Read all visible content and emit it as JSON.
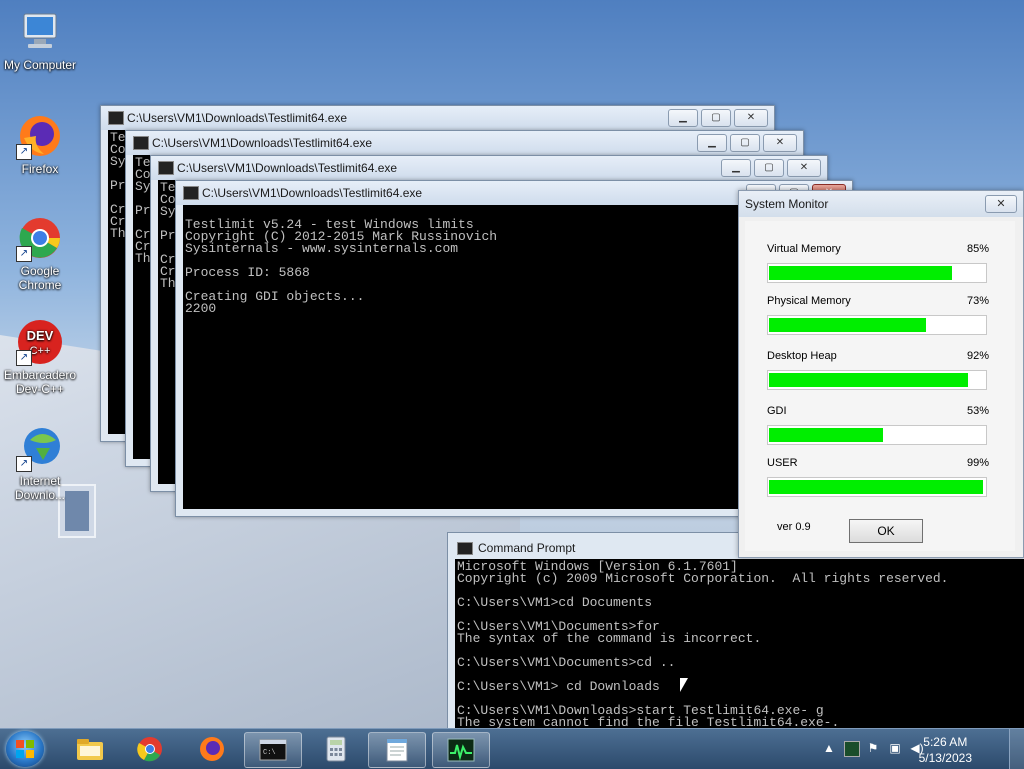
{
  "desktop": {
    "icons": [
      {
        "label": "My Computer"
      },
      {
        "label": "Firefox"
      },
      {
        "label": "Google Chrome"
      },
      {
        "label": "Embarcadero Dev-C++"
      },
      {
        "label": "Internet Downlo..."
      }
    ]
  },
  "console_windows": [
    {
      "title": "C:\\Users\\VM1\\Downloads\\Testlimit64.exe",
      "body": "Te\nCo\nSy\n\nPr\n\nCr\nCr\nTh"
    },
    {
      "title": "C:\\Users\\VM1\\Downloads\\Testlimit64.exe",
      "body": "Te\nCo\nSy\n\nPr\n\nCr\nCr\nTh"
    },
    {
      "title": "C:\\Users\\VM1\\Downloads\\Testlimit64.exe",
      "body": "Te\nCo\nSy\n\nPr\n\nCr\nCr\nTh"
    },
    {
      "title": "C:\\Users\\VM1\\Downloads\\Testlimit64.exe",
      "body": "\nTestlimit v5.24 - test Windows limits\nCopyright (C) 2012-2015 Mark Russinovich\nSysinternals - www.sysinternals.com\n\nProcess ID: 5868\n\nCreating GDI objects...\n2200"
    }
  ],
  "system_monitor": {
    "title": "System Monitor",
    "close_label": "✕",
    "meters": [
      {
        "label": "Virtual Memory",
        "percent_text": "85%",
        "value": 85
      },
      {
        "label": "Physical Memory",
        "percent_text": "73%",
        "value": 73
      },
      {
        "label": "Desktop Heap",
        "percent_text": "92%",
        "value": 92
      },
      {
        "label": "GDI",
        "percent_text": "53%",
        "value": 53
      },
      {
        "label": "USER",
        "percent_text": "99%",
        "value": 99
      }
    ],
    "version": "ver 0.9",
    "ok_label": "OK",
    "bar_color": "#00ee00"
  },
  "command_prompt": {
    "title": "Command Prompt",
    "body": "Microsoft Windows [Version 6.1.7601]\nCopyright (c) 2009 Microsoft Corporation.  All rights reserved.\n\nC:\\Users\\VM1>cd Documents\n\nC:\\Users\\VM1\\Documents>for\nThe syntax of the command is incorrect.\n\nC:\\Users\\VM1\\Documents>cd ..\n\nC:\\Users\\VM1> cd Downloads\n\nC:\\Users\\VM1\\Downloads>start Testlimit64.exe- g\nThe system cannot find the file Testlimit64.exe-."
  },
  "taskbar": {
    "time": "5:26 AM",
    "date": "5/13/2023",
    "icons": [
      "start-orb-icon",
      "explorer-icon",
      "chrome-icon",
      "firefox-icon",
      "cmd-icon",
      "calculator-icon",
      "notepad-icon",
      "system-monitor-icon"
    ]
  }
}
